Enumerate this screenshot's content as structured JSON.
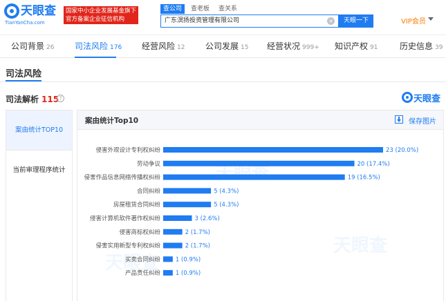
{
  "header": {
    "logo_text": "天眼查",
    "logo_domain": "TianYanCha.com",
    "badge_line1": "国家中小企业发展基金旗下",
    "badge_line2": "官方备案企业征信机构",
    "search_tabs": [
      "查公司",
      "查老板",
      "查关系"
    ],
    "search_value": "广东溟扬投资管理有限公司",
    "search_button": "天眼一下",
    "vip_label": "VIP会员"
  },
  "tabs": [
    {
      "label": "公司背景",
      "count": "26",
      "active": false
    },
    {
      "label": "司法风险",
      "count": "176",
      "active": true
    },
    {
      "label": "经营风险",
      "count": "12",
      "active": false
    },
    {
      "label": "公司发展",
      "count": "15",
      "active": false
    },
    {
      "label": "经营状况",
      "count": "999+",
      "active": false
    },
    {
      "label": "知识产权",
      "count": "91",
      "active": false
    },
    {
      "label": "历史信息",
      "count": "39",
      "active": false
    }
  ],
  "section": {
    "title": "司法风险",
    "analysis_title": "司法解析",
    "analysis_count": "115",
    "brand": "天眼查"
  },
  "left_nav": [
    {
      "label": "案由统计TOP10",
      "active": true
    },
    {
      "label": "当前审理程序统计",
      "active": false
    }
  ],
  "panel": {
    "title": "案由统计Top10",
    "save_label": "保存图片"
  },
  "colors": {
    "accent": "#1f7cf1",
    "bar": "#1f7cf1",
    "badge": "#e1251b",
    "vip": "#ff7a00"
  },
  "chart_data": {
    "type": "bar",
    "orientation": "horizontal",
    "categories": [
      "侵害外观设计专利权纠纷",
      "劳动争议",
      "侵害作品信息网络传播权纠纷",
      "合同纠纷",
      "房屋租赁合同纠纷",
      "侵害计算机软件著作权纠纷",
      "侵害商标权纠纷",
      "侵害实用新型专利权纠纷",
      "买卖合同纠纷",
      "产品责任纠纷"
    ],
    "values": [
      23,
      20,
      19,
      5,
      5,
      3,
      2,
      2,
      1,
      1
    ],
    "labels": [
      "23 (20.0%)",
      "20 (17.4%)",
      "19 (16.5%)",
      "5 (4.3%)",
      "5 (4.3%)",
      "3 (2.6%)",
      "2 (1.7%)",
      "2 (1.7%)",
      "1 (0.9%)",
      "1 (0.9%)"
    ],
    "xlim": [
      0,
      23
    ]
  }
}
